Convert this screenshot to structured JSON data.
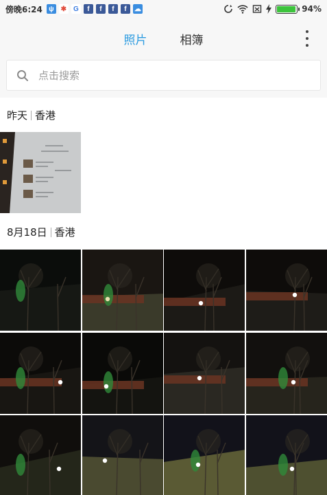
{
  "status_bar": {
    "time": "傍晚6:24",
    "battery_level": 0.94,
    "battery_text": "94%",
    "notification_icons": [
      "usb-icon",
      "pinwheel-icon",
      "google-icon",
      "facebook-icon",
      "facebook-icon",
      "facebook-icon",
      "facebook-icon",
      "cloud-icon"
    ]
  },
  "header": {
    "tabs": [
      {
        "label": "照片",
        "active": true
      },
      {
        "label": "相簿",
        "active": false
      }
    ],
    "accent_color": "#2b9be0"
  },
  "search": {
    "placeholder": "点击搜索"
  },
  "sections": [
    {
      "date": "昨天",
      "location": "香港",
      "photo_count": 1
    },
    {
      "date": "8月18日",
      "location": "香港",
      "photo_count": 12
    }
  ]
}
